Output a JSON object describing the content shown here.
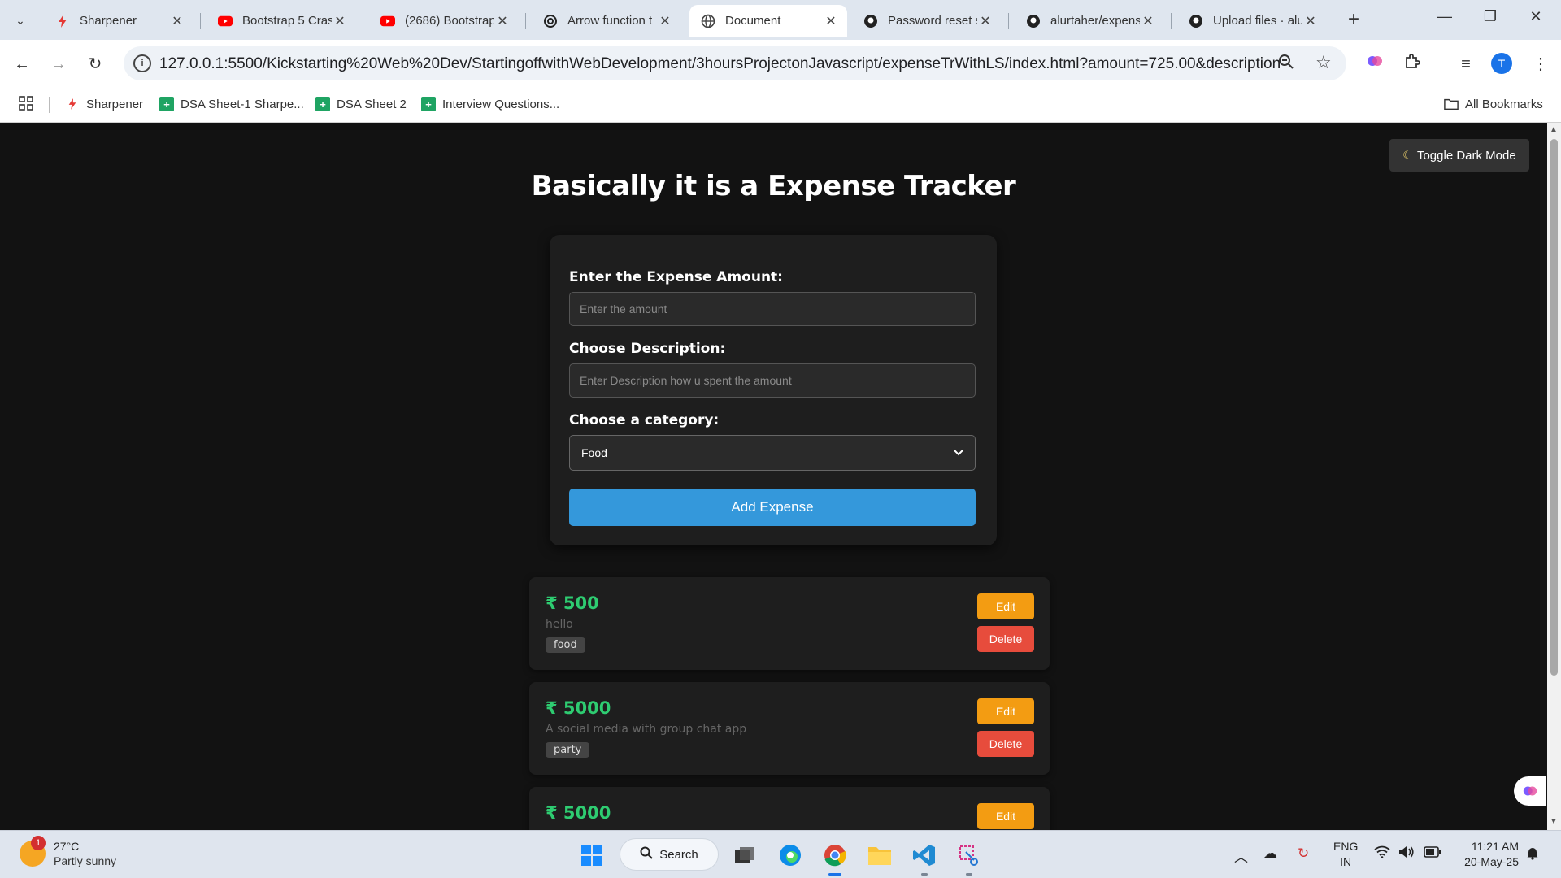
{
  "browser": {
    "tabs": [
      {
        "title": "Sharpener",
        "icon": "sharpener-bolt-icon"
      },
      {
        "title": "Bootstrap 5 Cras",
        "icon": "youtube-icon"
      },
      {
        "title": "(2686) Bootstrap",
        "icon": "youtube-icon"
      },
      {
        "title": "Arrow function t",
        "icon": "openai-icon"
      },
      {
        "title": "Document",
        "icon": "globe-icon"
      },
      {
        "title": "Password reset s",
        "icon": "github-icon"
      },
      {
        "title": "alurtaher/expens",
        "icon": "github-icon"
      },
      {
        "title": "Upload files · alu",
        "icon": "github-icon"
      }
    ],
    "active_tab": 4,
    "url": "127.0.0.1:5500/Kickstarting%20Web%20Dev/StartingoffwithWebDevelopment/3hoursProjectonJavascript/expenseTrWithLS/index.html?amount=725.00&description=ehjfjiekj&...",
    "profile_initial": "T",
    "bookmarks": [
      {
        "label": "Sharpener",
        "icon": "sharpener-bolt-icon"
      },
      {
        "label": "DSA Sheet-1 Sharpe...",
        "icon": "sheets-icon"
      },
      {
        "label": "DSA Sheet 2",
        "icon": "sheets-icon"
      },
      {
        "label": "Interview Questions...",
        "icon": "sheets-icon"
      }
    ],
    "all_bookmarks": "All Bookmarks"
  },
  "page": {
    "toggle_label": "Toggle Dark Mode",
    "title": "Basically it is a Expense Tracker",
    "form": {
      "amount_label": "Enter the Expense Amount:",
      "amount_placeholder": "Enter the amount",
      "description_label": "Choose Description:",
      "description_placeholder": "Enter Description how u spent the amount",
      "category_label": "Choose a category:",
      "category_selected": "Food",
      "submit_label": "Add Expense"
    },
    "expenses": [
      {
        "amount": "₹ 500",
        "description": "hello",
        "category": "food"
      },
      {
        "amount": "₹ 5000",
        "description": "A social media with group chat app",
        "category": "party"
      },
      {
        "amount": "₹ 5000",
        "description": "",
        "category": ""
      }
    ],
    "edit_label": "Edit",
    "delete_label": "Delete"
  },
  "taskbar": {
    "temperature": "27°C",
    "condition": "Partly sunny",
    "notification_count": "1",
    "search_label": "Search",
    "lang_line1": "ENG",
    "lang_line2": "IN",
    "time": "11:21 AM",
    "date": "20-May-25"
  },
  "colors": {
    "page_bg": "#121212",
    "card_bg": "#1e1e1e",
    "primary": "#3498db",
    "amount": "#2ecc71",
    "edit": "#f39c12",
    "delete": "#e74c3c"
  }
}
